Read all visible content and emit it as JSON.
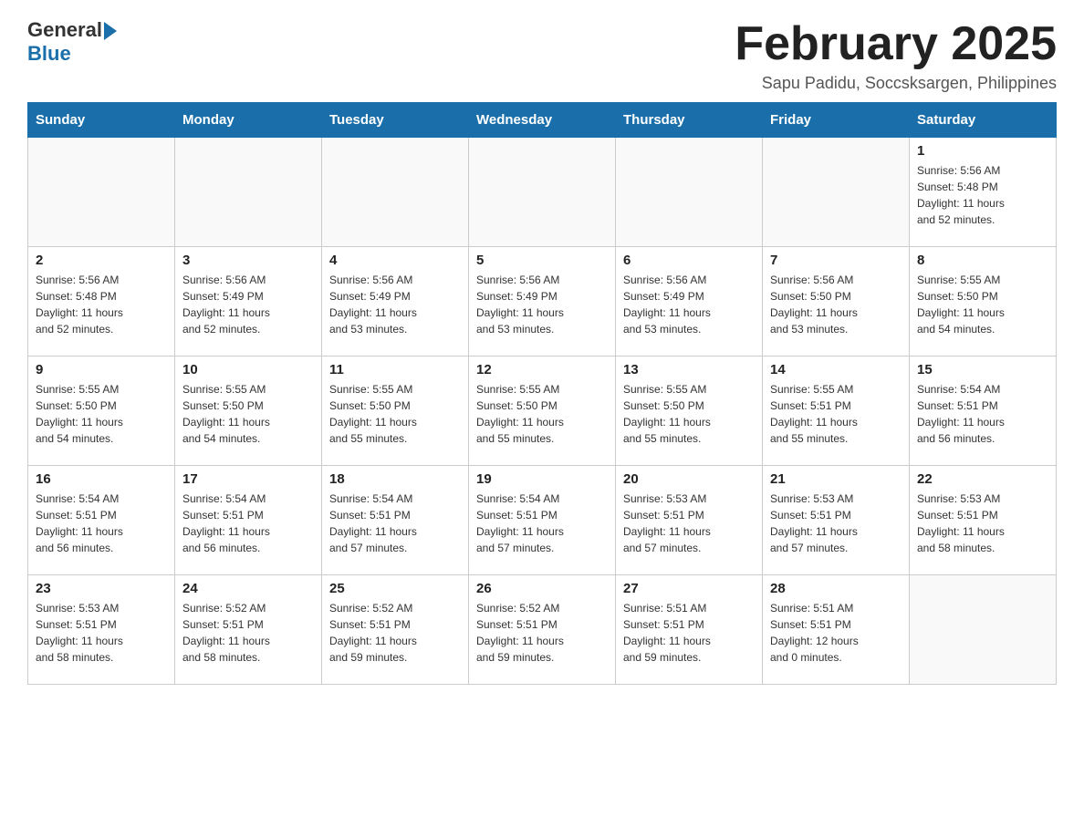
{
  "header": {
    "logo_general": "General",
    "logo_blue": "Blue",
    "month_title": "February 2025",
    "subtitle": "Sapu Padidu, Soccsksargen, Philippines"
  },
  "weekdays": [
    "Sunday",
    "Monday",
    "Tuesday",
    "Wednesday",
    "Thursday",
    "Friday",
    "Saturday"
  ],
  "weeks": [
    [
      {
        "day": "",
        "info": ""
      },
      {
        "day": "",
        "info": ""
      },
      {
        "day": "",
        "info": ""
      },
      {
        "day": "",
        "info": ""
      },
      {
        "day": "",
        "info": ""
      },
      {
        "day": "",
        "info": ""
      },
      {
        "day": "1",
        "info": "Sunrise: 5:56 AM\nSunset: 5:48 PM\nDaylight: 11 hours\nand 52 minutes."
      }
    ],
    [
      {
        "day": "2",
        "info": "Sunrise: 5:56 AM\nSunset: 5:48 PM\nDaylight: 11 hours\nand 52 minutes."
      },
      {
        "day": "3",
        "info": "Sunrise: 5:56 AM\nSunset: 5:49 PM\nDaylight: 11 hours\nand 52 minutes."
      },
      {
        "day": "4",
        "info": "Sunrise: 5:56 AM\nSunset: 5:49 PM\nDaylight: 11 hours\nand 53 minutes."
      },
      {
        "day": "5",
        "info": "Sunrise: 5:56 AM\nSunset: 5:49 PM\nDaylight: 11 hours\nand 53 minutes."
      },
      {
        "day": "6",
        "info": "Sunrise: 5:56 AM\nSunset: 5:49 PM\nDaylight: 11 hours\nand 53 minutes."
      },
      {
        "day": "7",
        "info": "Sunrise: 5:56 AM\nSunset: 5:50 PM\nDaylight: 11 hours\nand 53 minutes."
      },
      {
        "day": "8",
        "info": "Sunrise: 5:55 AM\nSunset: 5:50 PM\nDaylight: 11 hours\nand 54 minutes."
      }
    ],
    [
      {
        "day": "9",
        "info": "Sunrise: 5:55 AM\nSunset: 5:50 PM\nDaylight: 11 hours\nand 54 minutes."
      },
      {
        "day": "10",
        "info": "Sunrise: 5:55 AM\nSunset: 5:50 PM\nDaylight: 11 hours\nand 54 minutes."
      },
      {
        "day": "11",
        "info": "Sunrise: 5:55 AM\nSunset: 5:50 PM\nDaylight: 11 hours\nand 55 minutes."
      },
      {
        "day": "12",
        "info": "Sunrise: 5:55 AM\nSunset: 5:50 PM\nDaylight: 11 hours\nand 55 minutes."
      },
      {
        "day": "13",
        "info": "Sunrise: 5:55 AM\nSunset: 5:50 PM\nDaylight: 11 hours\nand 55 minutes."
      },
      {
        "day": "14",
        "info": "Sunrise: 5:55 AM\nSunset: 5:51 PM\nDaylight: 11 hours\nand 55 minutes."
      },
      {
        "day": "15",
        "info": "Sunrise: 5:54 AM\nSunset: 5:51 PM\nDaylight: 11 hours\nand 56 minutes."
      }
    ],
    [
      {
        "day": "16",
        "info": "Sunrise: 5:54 AM\nSunset: 5:51 PM\nDaylight: 11 hours\nand 56 minutes."
      },
      {
        "day": "17",
        "info": "Sunrise: 5:54 AM\nSunset: 5:51 PM\nDaylight: 11 hours\nand 56 minutes."
      },
      {
        "day": "18",
        "info": "Sunrise: 5:54 AM\nSunset: 5:51 PM\nDaylight: 11 hours\nand 57 minutes."
      },
      {
        "day": "19",
        "info": "Sunrise: 5:54 AM\nSunset: 5:51 PM\nDaylight: 11 hours\nand 57 minutes."
      },
      {
        "day": "20",
        "info": "Sunrise: 5:53 AM\nSunset: 5:51 PM\nDaylight: 11 hours\nand 57 minutes."
      },
      {
        "day": "21",
        "info": "Sunrise: 5:53 AM\nSunset: 5:51 PM\nDaylight: 11 hours\nand 57 minutes."
      },
      {
        "day": "22",
        "info": "Sunrise: 5:53 AM\nSunset: 5:51 PM\nDaylight: 11 hours\nand 58 minutes."
      }
    ],
    [
      {
        "day": "23",
        "info": "Sunrise: 5:53 AM\nSunset: 5:51 PM\nDaylight: 11 hours\nand 58 minutes."
      },
      {
        "day": "24",
        "info": "Sunrise: 5:52 AM\nSunset: 5:51 PM\nDaylight: 11 hours\nand 58 minutes."
      },
      {
        "day": "25",
        "info": "Sunrise: 5:52 AM\nSunset: 5:51 PM\nDaylight: 11 hours\nand 59 minutes."
      },
      {
        "day": "26",
        "info": "Sunrise: 5:52 AM\nSunset: 5:51 PM\nDaylight: 11 hours\nand 59 minutes."
      },
      {
        "day": "27",
        "info": "Sunrise: 5:51 AM\nSunset: 5:51 PM\nDaylight: 11 hours\nand 59 minutes."
      },
      {
        "day": "28",
        "info": "Sunrise: 5:51 AM\nSunset: 5:51 PM\nDaylight: 12 hours\nand 0 minutes."
      },
      {
        "day": "",
        "info": ""
      }
    ]
  ]
}
